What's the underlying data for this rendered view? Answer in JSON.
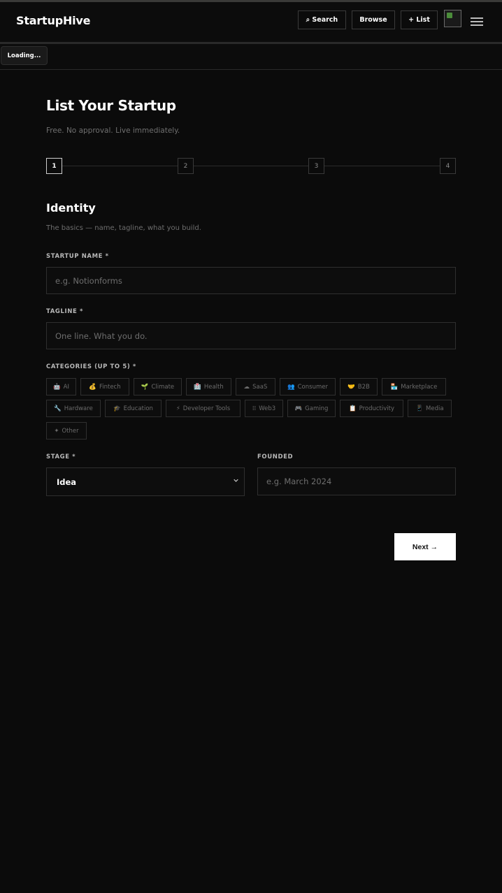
{
  "navbar": {
    "brand": "StartupHive",
    "search_label": "⌕ Search",
    "browse_label": "Browse",
    "list_label": "+ List"
  },
  "status": {
    "loading": "Loading..."
  },
  "page": {
    "title": "List Your Startup",
    "subtitle": "Free. No approval. Live immediately."
  },
  "stepper": {
    "steps": [
      "1",
      "2",
      "3",
      "4"
    ],
    "active": 1
  },
  "section": {
    "title": "Identity",
    "subtitle": "The basics — name, tagline, what you build."
  },
  "form": {
    "name_label": "STARTUP NAME *",
    "name_placeholder": "e.g. Notionforms",
    "tagline_label": "TAGLINE *",
    "tagline_placeholder": "One line. What you do.",
    "categories_label": "CATEGORIES (UP TO 5) *",
    "categories": [
      {
        "icon": "🤖",
        "label": "AI"
      },
      {
        "icon": "💰",
        "label": "Fintech"
      },
      {
        "icon": "🌱",
        "label": "Climate"
      },
      {
        "icon": "🏥",
        "label": "Health"
      },
      {
        "icon": "☁",
        "label": "SaaS"
      },
      {
        "icon": "👥",
        "label": "Consumer"
      },
      {
        "icon": "🤝",
        "label": "B2B"
      },
      {
        "icon": "🏪",
        "label": "Marketplace"
      },
      {
        "icon": "🔧",
        "label": "Hardware"
      },
      {
        "icon": "🎓",
        "label": "Education"
      },
      {
        "icon": "⚡",
        "label": "Developer Tools"
      },
      {
        "icon": "⁞⁞",
        "label": "Web3"
      },
      {
        "icon": "🎮",
        "label": "Gaming"
      },
      {
        "icon": "📋",
        "label": "Productivity"
      },
      {
        "icon": "📱",
        "label": "Media"
      },
      {
        "icon": "✦",
        "label": "Other"
      }
    ],
    "stage_label": "STAGE *",
    "stage_value": "Idea",
    "founded_label": "FOUNDED",
    "founded_placeholder": "e.g. March 2024"
  },
  "actions": {
    "next_label": "Next →"
  },
  "colors": {
    "background": "#0b0b0b",
    "accent": "#ffffff",
    "muted": "#6e6e6e"
  }
}
